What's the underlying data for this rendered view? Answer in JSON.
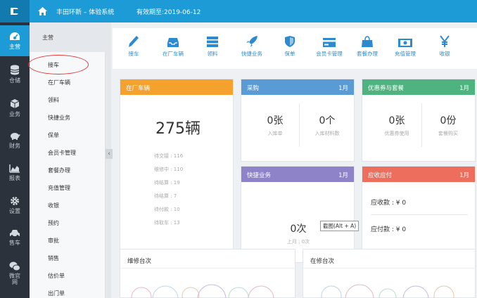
{
  "header": {
    "title": "丰田环新 – 体验系统",
    "expire": "有效期至:2019-06-12"
  },
  "leftnav": [
    {
      "label": "主营",
      "icon": "dashboard-icon",
      "active": true
    },
    {
      "label": "仓储",
      "icon": "database-icon"
    },
    {
      "label": "业务",
      "icon": "cube-icon"
    },
    {
      "label": "财务",
      "icon": "piggy-bank-icon"
    },
    {
      "label": "报表",
      "icon": "area-chart-icon"
    },
    {
      "label": "设置",
      "icon": "gear-icon"
    },
    {
      "label": "售车",
      "icon": "car-icon"
    },
    {
      "label": "微官网",
      "icon": "wechat-icon"
    }
  ],
  "submenu": {
    "head": "主营",
    "items": [
      "接车",
      "在厂车辆",
      "领料",
      "快捷业务",
      "保单",
      "会员卡管理",
      "套餐办理",
      "充值管理",
      "收银",
      "预约",
      "审批",
      "销售",
      "估价单",
      "出门单"
    ]
  },
  "quickbar": [
    {
      "label": "接车",
      "icon": "pencil-icon"
    },
    {
      "label": "在厂车辆",
      "icon": "inbox-icon"
    },
    {
      "label": "领料",
      "icon": "server-icon"
    },
    {
      "label": "快捷业务",
      "icon": "rocket-icon"
    },
    {
      "label": "保单",
      "icon": "shield-icon"
    },
    {
      "label": "会员卡管理",
      "icon": "card-icon"
    },
    {
      "label": "套餐办理",
      "icon": "bag-icon"
    },
    {
      "label": "充值管理",
      "icon": "money-icon"
    },
    {
      "label": "收银",
      "icon": "yen-icon"
    }
  ],
  "cards": {
    "vehicles": {
      "title": "在厂车辆",
      "total": "275辆",
      "rows": [
        "待交接 : 116",
        "维修中 : 110",
        "待结算 : 19",
        "待结算 : 7",
        "待付款 : 10",
        "待取车 : 13"
      ],
      "color": "#f4a22d"
    },
    "purchase": {
      "title": "采购",
      "month": "1月",
      "a_val": "0张",
      "a_lbl": "入库单",
      "b_val": "0个",
      "b_lbl": "入库材料数",
      "color": "#5b9bd5"
    },
    "coupon": {
      "title": "优惠券与套餐",
      "month": "1月",
      "a_val": "0张",
      "a_lbl": "优惠券使用",
      "b_val": "0份",
      "b_lbl": "套餐购买",
      "color": "#4fb37f"
    },
    "quick": {
      "title": "快捷业务",
      "month": "1月",
      "val": "0次",
      "sub": "上月 : 0次",
      "color": "#8e83c9"
    },
    "receivable": {
      "title": "应收应付",
      "month": "1月",
      "recv": "应收款 : ¥ 0",
      "pay": "应付款 : ¥ 0",
      "color": "#ee6e5d"
    }
  },
  "tooltip": "截图(Alt + A)",
  "bottom": {
    "left_title": "维修台次",
    "right_title": "在修台次"
  }
}
